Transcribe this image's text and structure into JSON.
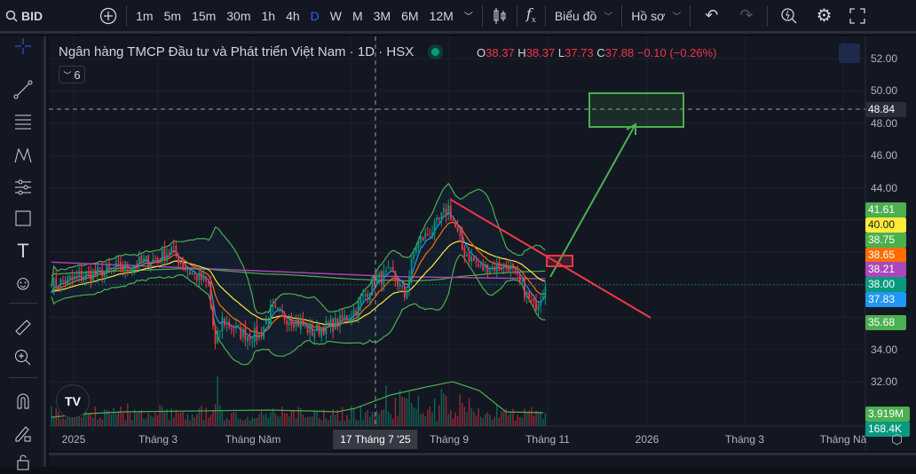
{
  "toolbar": {
    "symbol": "BID",
    "timeframes": [
      "1m",
      "5m",
      "15m",
      "30m",
      "1h",
      "4h",
      "D",
      "W",
      "M",
      "3M",
      "6M",
      "12M"
    ],
    "active_timeframe": "D",
    "chart_menu": "Biểu đồ",
    "profile_menu": "Hồ sơ"
  },
  "legend": {
    "title": "Ngân hàng TMCP Đầu tư và Phát triển Việt Nam · 1D · HSX",
    "o_label": "O",
    "o": "38.37",
    "h_label": "H",
    "h": "38.37",
    "l_label": "L",
    "l": "37.73",
    "c_label": "C",
    "c": "37.88",
    "change": "−0.10 (−0.26%)",
    "indicators_count": "6"
  },
  "price_axis": {
    "ticks": [
      "52.00",
      "50.00",
      "48.00",
      "46.00",
      "44.00",
      "34.00",
      "32.00"
    ],
    "crosshair_price": "48.84"
  },
  "price_labels": [
    {
      "value": "41.61",
      "color": "#4caf50",
      "text": "#ffffff"
    },
    {
      "value": "40.00",
      "color": "#ffeb3b",
      "text": "#131722"
    },
    {
      "value": "38.75",
      "color": "#4caf50",
      "text": "#ffffff"
    },
    {
      "value": "38.65",
      "color": "#ff6d00",
      "text": "#ffffff"
    },
    {
      "value": "38.21",
      "color": "#ab47bc",
      "text": "#ffffff"
    },
    {
      "value": "38.00",
      "color": "#089981",
      "text": "#ffffff"
    },
    {
      "value": "37.83",
      "color": "#2196f3",
      "text": "#ffffff"
    },
    {
      "value": "35.68",
      "color": "#4caf50",
      "text": "#ffffff"
    },
    {
      "value": "3.919M",
      "color": "#4caf50",
      "text": "#ffffff"
    },
    {
      "value": "168.4K",
      "color": "#089981",
      "text": "#ffffff"
    }
  ],
  "time_axis": {
    "labels": [
      "2025",
      "Tháng 3",
      "Tháng Năm",
      "Tháng 9",
      "Tháng 11",
      "2026",
      "Tháng 3",
      "Tháng Nă"
    ],
    "crosshair_date": "17 Tháng 7 '25"
  },
  "colors": {
    "up": "#089981",
    "down": "#f23645",
    "accent": "#2962ff"
  },
  "price_series": {
    "keypoints": [
      [
        0,
        38.0
      ],
      [
        16,
        38.6
      ],
      [
        28,
        39.0
      ],
      [
        46,
        39.6
      ],
      [
        52,
        40.2
      ],
      [
        58,
        39.0
      ],
      [
        68,
        38.0
      ],
      [
        71,
        34.2
      ],
      [
        74,
        35.8
      ],
      [
        82,
        35.0
      ],
      [
        90,
        34.8
      ],
      [
        95,
        36.4
      ],
      [
        105,
        35.8
      ],
      [
        113,
        35.1
      ],
      [
        125,
        35.7
      ],
      [
        132,
        36.5
      ],
      [
        140,
        38.3
      ],
      [
        148,
        38.7
      ],
      [
        153,
        37.3
      ],
      [
        158,
        40.5
      ],
      [
        166,
        41.5
      ],
      [
        172,
        42.8
      ],
      [
        178,
        40.2
      ],
      [
        186,
        39.0
      ],
      [
        198,
        39.2
      ],
      [
        205,
        37.6
      ],
      [
        209,
        36.6
      ],
      [
        214,
        37.88
      ]
    ]
  }
}
